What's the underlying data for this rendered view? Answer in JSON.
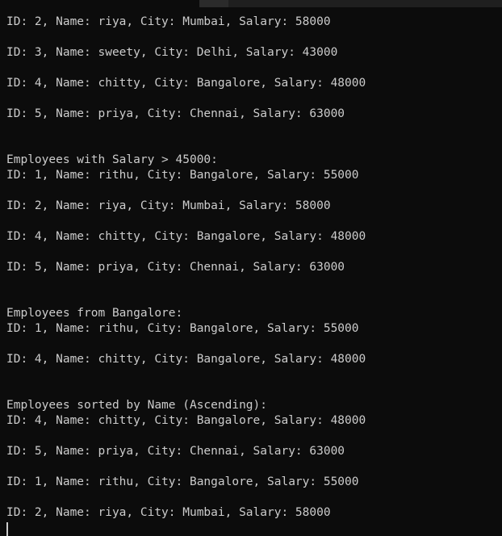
{
  "terminal": {
    "output_lines": [
      "ID: 2, Name: riya, City: Mumbai, Salary: 58000",
      "ID: 3, Name: sweety, City: Delhi, Salary: 43000",
      "ID: 4, Name: chitty, City: Bangalore, Salary: 48000",
      "ID: 5, Name: priya, City: Chennai, Salary: 63000",
      "Employees with Salary > 45000:",
      "ID: 1, Name: rithu, City: Bangalore, Salary: 55000",
      "ID: 2, Name: riya, City: Mumbai, Salary: 58000",
      "ID: 4, Name: chitty, City: Bangalore, Salary: 48000",
      "ID: 5, Name: priya, City: Chennai, Salary: 63000",
      "Employees from Bangalore:",
      "ID: 1, Name: rithu, City: Bangalore, Salary: 55000",
      "ID: 4, Name: chitty, City: Bangalore, Salary: 48000",
      "Employees sorted by Name (Ascending):",
      "ID: 4, Name: chitty, City: Bangalore, Salary: 48000",
      "ID: 5, Name: priya, City: Chennai, Salary: 63000",
      "ID: 1, Name: rithu, City: Bangalore, Salary: 55000",
      "ID: 2, Name: riya, City: Mumbai, Salary: 58000"
    ]
  },
  "colors": {
    "background": "#0c0c0c",
    "text": "#cccccc"
  }
}
